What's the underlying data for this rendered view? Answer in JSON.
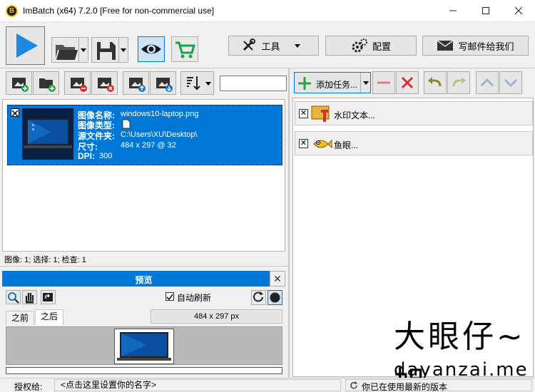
{
  "window": {
    "title": "ImBatch (x64) 7.2.0 [Free for non-commercial use]",
    "app_icon_letter": "B"
  },
  "toolbar": {
    "tools_label": "工具",
    "config_label": "配置",
    "email_label": "写邮件给我们"
  },
  "image_panel": {
    "item": {
      "name_label": "图像名称:",
      "name_value": "windows10-laptop.png",
      "type_label": "图像类型:",
      "folder_label": "源文件夹:",
      "folder_value": "C:\\Users\\XU\\Desktop\\",
      "size_label": "尺寸:",
      "size_value": "484 x 297 @ 32",
      "dpi_label": "DPI:",
      "dpi_value": "300"
    },
    "status": "图像: 1; 选择: 1; 检查: 1"
  },
  "preview": {
    "title": "预览",
    "auto_refresh_label": "自动刷新",
    "tab_before": "之前",
    "tab_after": "之后",
    "dimensions": "484 x 297 px"
  },
  "tasks_panel": {
    "add_task_label": "添加任务...",
    "tasks": [
      {
        "label": "水印文本..."
      },
      {
        "label": "鱼眼..."
      }
    ]
  },
  "status_bar": {
    "license_label": "授权给:",
    "license_value": "<点击这里设置你的名字>",
    "version_status": "你已在使用最新的版本"
  },
  "watermark": {
    "chinese": "大眼仔~旭",
    "domain": "dayanzai.me"
  }
}
